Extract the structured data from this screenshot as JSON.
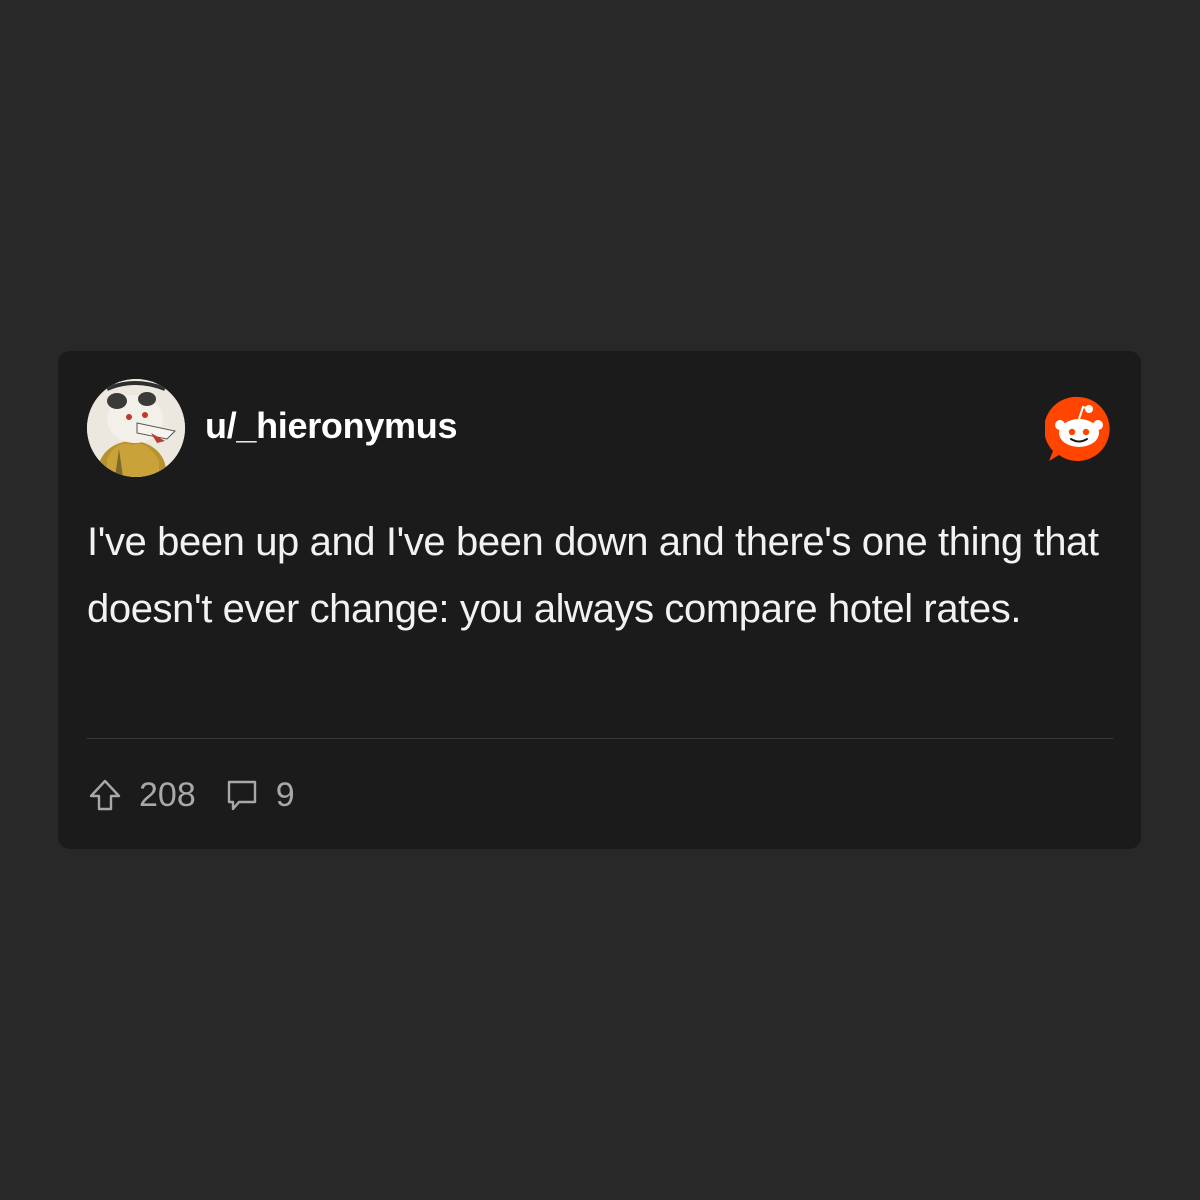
{
  "post": {
    "username": "u/_hieronymus",
    "text": "I've been up and I've been down and there's one thing that doesn't ever change: you always compare hotel rates.",
    "upvotes": "208",
    "comments": "9"
  },
  "icons": {
    "avatar": "opossum-avatar",
    "brand": "reddit-logo-icon",
    "upvote": "upvote-arrow-icon",
    "comment": "comment-bubble-icon"
  },
  "colors": {
    "page_background": "#282828",
    "card_background": "#1b1b1b",
    "reddit_orange": "#ff4500",
    "text_primary": "#ffffff",
    "text_muted": "#9a9a9a"
  }
}
